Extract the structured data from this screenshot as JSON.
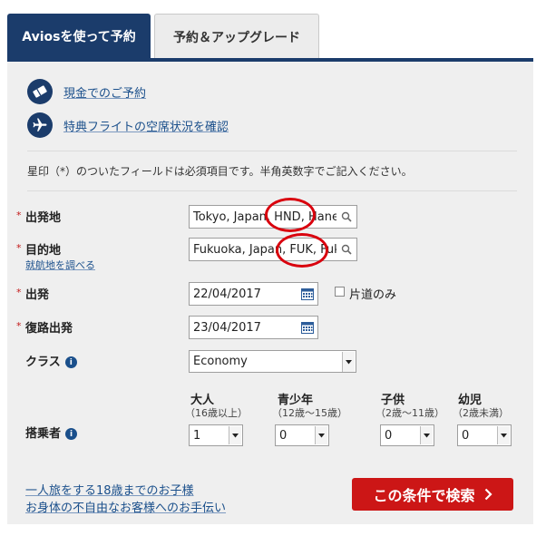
{
  "tabs": [
    {
      "label": "Aviosを使って予約",
      "active": true
    },
    {
      "label": "予約＆アップグレード",
      "active": false
    }
  ],
  "top_links": [
    {
      "label": "現金でのご予約",
      "icon": "ticket-icon"
    },
    {
      "label": "特典フライトの空席状況を確認",
      "icon": "airplane-icon"
    }
  ],
  "notice": "星印（*）のついたフィールドは必須項目です。半角英数字でご記入ください。",
  "form": {
    "required_mark": "*",
    "origin": {
      "label": "出発地",
      "value": "Tokyo, Japan, HND, Haneda"
    },
    "destination": {
      "label": "目的地",
      "value": "Fukuoka, Japan, FUK, Fukuoka",
      "sublink": "就航地を調べる"
    },
    "depart": {
      "label": "出発",
      "value": "22/04/2017"
    },
    "one_way": {
      "label": "片道のみ",
      "checked": false
    },
    "return": {
      "label": "復路出発",
      "value": "23/04/2017"
    },
    "cabin": {
      "label": "クラス",
      "value": "Economy"
    },
    "passengers": {
      "label": "搭乗者",
      "groups": [
        {
          "title": "大人",
          "sub": "（16歳以上）",
          "value": "1"
        },
        {
          "title": "青少年",
          "sub": "（12歳〜15歳）",
          "value": "0"
        },
        {
          "title": "子供",
          "sub": "（2歳〜11歳）",
          "value": "0"
        },
        {
          "title": "幼児",
          "sub": "（2歳未満）",
          "value": "0"
        }
      ]
    }
  },
  "footer_links": [
    "一人旅をする18歳までのお子様",
    "お身体の不自由なお客様へのお手伝い"
  ],
  "search_button": "この条件で検索",
  "colors": {
    "navy": "#1b3c6b",
    "link": "#1a4f8b",
    "red": "#cc1616",
    "annotation": "#d9000d"
  }
}
